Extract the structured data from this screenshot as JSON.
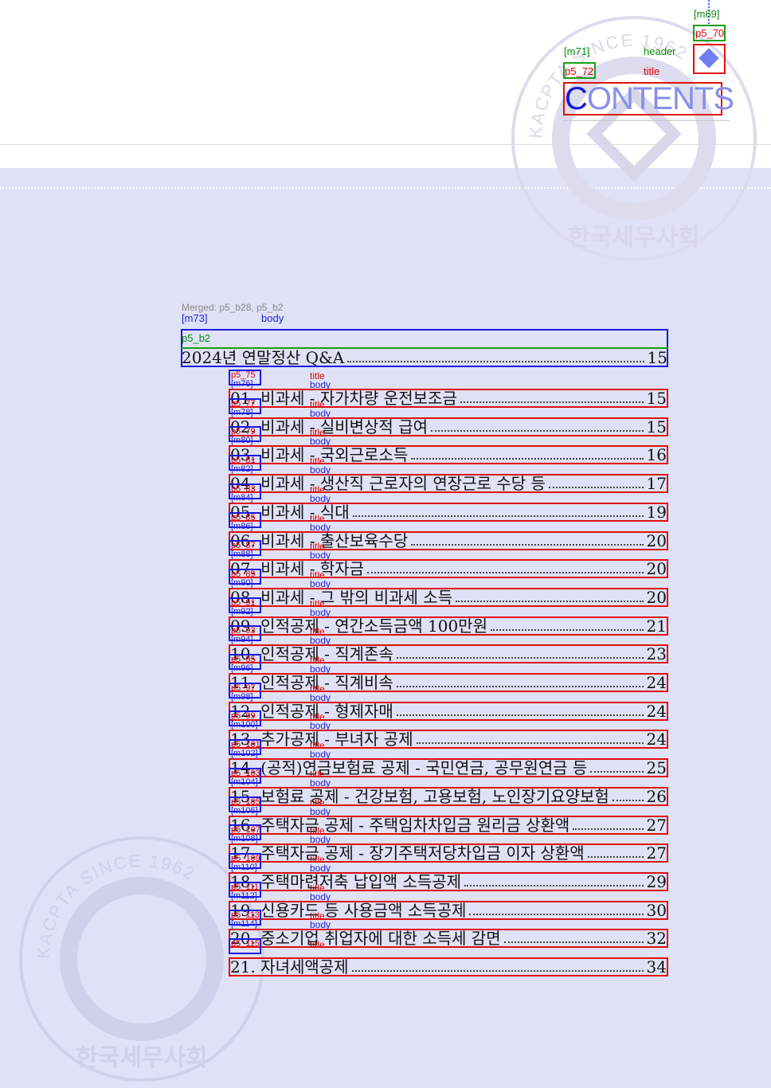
{
  "header": {
    "contents_title_first": "C",
    "contents_title_rest": "ONTENTS",
    "label_m69": "[m69]",
    "label_p570": "p5_70",
    "label_m71": "[m71]",
    "label_header": "header",
    "label_p572": "p5_72",
    "label_title": "title"
  },
  "watermark": {
    "arc_text": "KACPTA SINCE 1962",
    "korean_text": "한국세무사회"
  },
  "body_block": {
    "merged_note": "Merged: p5_b28, p5_b2",
    "label_m73": "[m73]",
    "label_body": "body",
    "label_p5_b2": "p5_b2"
  },
  "toc": {
    "main": {
      "title": "2024년 연말정산 Q&A",
      "page": "15"
    },
    "items": [
      {
        "title": "01. 비과세 - 자가차량 운전보조금",
        "page": "15"
      },
      {
        "title": "02. 비과세 - 실비변상적 급여",
        "page": "15"
      },
      {
        "title": "03. 비과세 - 국외근로소득",
        "page": "16"
      },
      {
        "title": "04. 비과세 - 생산직 근로자의 연장근로 수당 등",
        "page": "17"
      },
      {
        "title": "05. 비과세 - 식대",
        "page": "19"
      },
      {
        "title": "06. 비과세 - 출산보육수당",
        "page": "20"
      },
      {
        "title": "07. 비과세 - 학자금",
        "page": "20"
      },
      {
        "title": "08. 비과세 - 그 밖의 비과세 소득",
        "page": "20"
      },
      {
        "title": "09. 인적공제 - 연간소득금액 100만원",
        "page": "21"
      },
      {
        "title": "10. 인적공제 - 직계존속",
        "page": "23"
      },
      {
        "title": "11. 인적공제 - 직계비속",
        "page": "24"
      },
      {
        "title": "12. 인적공제 - 형제자매",
        "page": "24"
      },
      {
        "title": "13. 추가공제 - 부녀자 공제",
        "page": "24"
      },
      {
        "title": "14. (공적)연금보험료 공제 - 국민연금, 공무원연금 등",
        "page": "25"
      },
      {
        "title": "15. 보험료 공제 - 건강보험, 고용보험, 노인장기요양보험",
        "page": "26"
      },
      {
        "title": "16. 주택자금 공제 - 주택임차차입금 원리금 상환액",
        "page": "27"
      },
      {
        "title": "17. 주택자금 공제 - 장기주택저당차입금 이자 상환액",
        "page": "27"
      },
      {
        "title": "18. 주택마련저축 납입액 소득공제",
        "page": "29"
      },
      {
        "title": "19. 신용카드 등 사용금액 소득공제",
        "page": "30"
      },
      {
        "title": "20. 중소기업 취업자에 대한 소득세 감면",
        "page": "32"
      },
      {
        "title": "21. 자녀세액공제",
        "page": "34"
      }
    ],
    "row_labels": [
      {
        "id": "p5_75",
        "m": "[m76]"
      },
      {
        "id": "p5_77",
        "m": "[m78]"
      },
      {
        "id": "p5_79",
        "m": "[m80]"
      },
      {
        "id": "p5_81",
        "m": "[m82]"
      },
      {
        "id": "p5_83",
        "m": "[m84]"
      },
      {
        "id": "p5_85",
        "m": "[m86]"
      },
      {
        "id": "p5_87",
        "m": "[m88]"
      },
      {
        "id": "p5_89",
        "m": "[m90]"
      },
      {
        "id": "p5_91",
        "m": "[m92]"
      },
      {
        "id": "p5_93",
        "m": "[m94]"
      },
      {
        "id": "p5_95",
        "m": "[m96]"
      },
      {
        "id": "p5_97",
        "m": "[m98]"
      },
      {
        "id": "p5_99",
        "m": "[m100]"
      },
      {
        "id": "p5_101",
        "m": "[m102]"
      },
      {
        "id": "p5_103",
        "m": "[m104]"
      },
      {
        "id": "p5_105",
        "m": "[m106]"
      },
      {
        "id": "p5_107",
        "m": "[m108]"
      },
      {
        "id": "p5_109",
        "m": "[m110]"
      },
      {
        "id": "p5_111",
        "m": "[m112]"
      },
      {
        "id": "p5_113",
        "m": "[m114]"
      },
      {
        "id": "p5_115",
        "m": ""
      }
    ],
    "title_word": "title",
    "body_word": "body"
  },
  "colors": {
    "annotation_red": "#e01010",
    "annotation_blue": "#1a1ae0",
    "annotation_green": "#18a018",
    "lavender_band": "#dfe1f6",
    "contents_accent": "#1515e0"
  }
}
